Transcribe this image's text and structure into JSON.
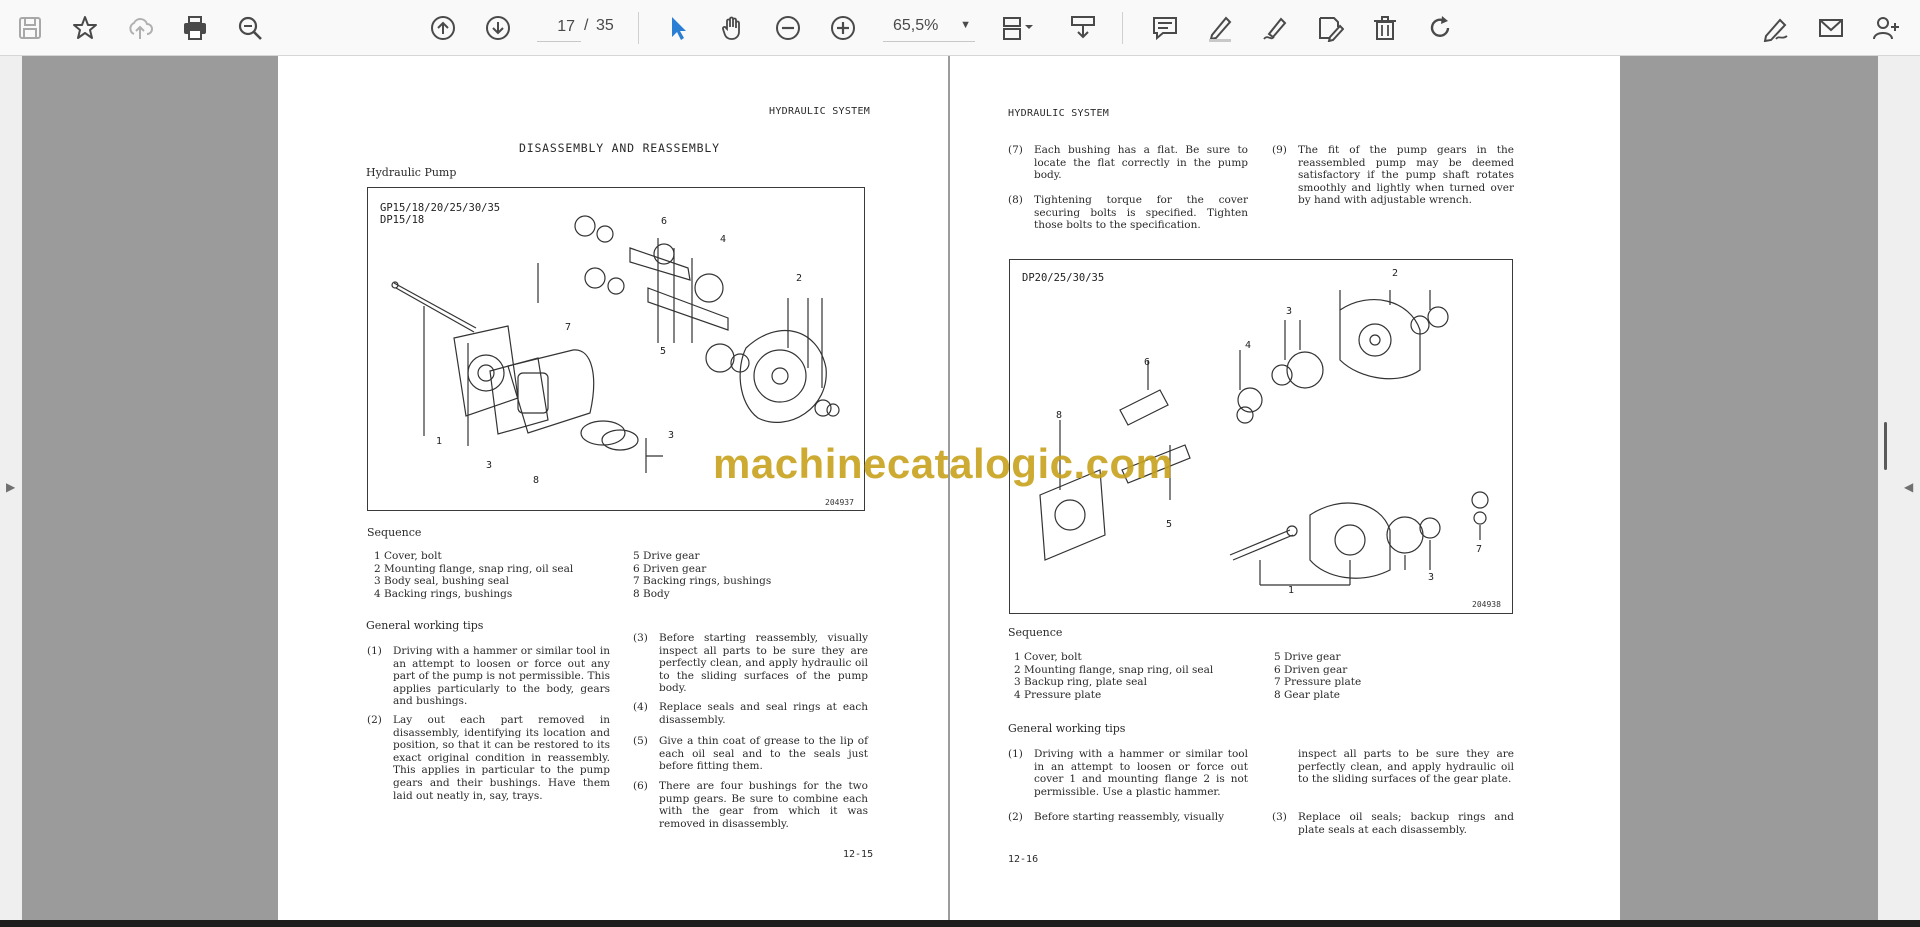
{
  "toolbar": {
    "page_current": "17",
    "page_separator": "/",
    "page_total": "35",
    "zoom": "65,5%",
    "accent_color": "#2a7fd4",
    "icons": [
      "save-icon",
      "bookmark-star-icon",
      "upload-cloud-icon",
      "print-icon",
      "zoom-search-icon",
      "page-up-icon",
      "page-down-icon",
      "select-cursor-icon",
      "hand-pan-icon",
      "zoom-out-icon",
      "zoom-in-icon",
      "page-fit-icon",
      "scroll-mode-icon",
      "comment-icon",
      "highlight-pen-icon",
      "draw-icon",
      "edit-text-icon",
      "delete-trash-icon",
      "rotate-icon",
      "sign-icon",
      "email-icon",
      "add-user-icon"
    ]
  },
  "left_page": {
    "header": "HYDRAULIC SYSTEM",
    "title": "DISASSEMBLY AND REASSEMBLY",
    "subtitle": "Hydraulic Pump",
    "figure": {
      "model_label": "GP15/18/20/25/30/35\nDP15/18",
      "code": "204937",
      "callouts": [
        "6",
        "4",
        "7",
        "2",
        "5",
        "1",
        "3",
        "3",
        "8"
      ]
    },
    "sequence_title": "Sequence",
    "sequence_col1": [
      "1  Cover, bolt",
      "2  Mounting flange, snap ring, oil seal",
      "3  Body seal, bushing seal",
      "4  Backing rings, bushings"
    ],
    "sequence_col2": [
      "5  Drive gear",
      "6  Driven gear",
      "7  Backing rings, bushings",
      "8  Body"
    ],
    "tips_title": "General working tips",
    "tips_col1": [
      {
        "n": "(1)",
        "text": "Driving with a hammer or similar tool in an attempt to loosen or force out any part of the pump is not permissible. This applies particularly to the body, gears and bushings."
      },
      {
        "n": "(2)",
        "text": "Lay out each part removed in disassembly, identifying its location and position, so that it can be restored to its exact original condition in reassembly. This applies in particular to the pump gears and their bushings. Have them laid out neatly in, say, trays."
      }
    ],
    "tips_col2": [
      {
        "n": "(3)",
        "text": "Before starting reassembly, visually inspect all parts to be sure they are perfectly clean, and apply hydraulic oil to the sliding surfaces of the pump body."
      },
      {
        "n": "(4)",
        "text": "Replace seals and seal rings at each disassembly."
      },
      {
        "n": "(5)",
        "text": "Give a thin coat of grease to the lip of each oil seal and to the seals just before fitting them."
      },
      {
        "n": "(6)",
        "text": "There are four bushings for the two pump gears. Be sure to combine each with the gear from which it was removed in disassembly."
      }
    ],
    "page_number": "12-15"
  },
  "right_page": {
    "header": "HYDRAULIC SYSTEM",
    "top_col1": [
      {
        "n": "(7)",
        "text": "Each bushing has a flat. Be sure to locate the flat correctly in the pump body."
      },
      {
        "n": "(8)",
        "text": "Tightening torque for the cover securing bolts is specified. Tighten those bolts to the specification."
      }
    ],
    "top_col2": [
      {
        "n": "(9)",
        "text": "The fit of the pump gears in the reassembled pump may be deemed satisfactory if the pump shaft rotates smoothly and lightly when turned over by hand with adjustable wrench."
      }
    ],
    "figure": {
      "model_label": "DP20/25/30/35",
      "code": "204938",
      "callouts": [
        "2",
        "3",
        "6",
        "4",
        "8",
        "5",
        "1",
        "3",
        "7"
      ]
    },
    "sequence_title": "Sequence",
    "sequence_col1": [
      "1  Cover, bolt",
      "2  Mounting flange, snap ring, oil seal",
      "3  Backup ring, plate seal",
      "4  Pressure plate"
    ],
    "sequence_col2": [
      "5  Drive gear",
      "6  Driven gear",
      "7  Pressure plate",
      "8  Gear plate"
    ],
    "tips_title": "General working tips",
    "tips_col1": [
      {
        "n": "(1)",
        "text": "Driving with a hammer or similar tool in an attempt to loosen or force out cover 1 and mounting flange 2 is not permissible. Use a plastic hammer."
      },
      {
        "n": "(2)",
        "text": "Before starting reassembly, visually"
      }
    ],
    "tips_col2": [
      {
        "n": "",
        "text": "inspect all parts to be sure they are perfectly clean, and apply hydraulic oil to the sliding surfaces of the gear plate."
      },
      {
        "n": "(3)",
        "text": "Replace oil seals; backup rings and plate seals at each disassembly."
      }
    ],
    "page_number": "12-16"
  },
  "watermark": "machinecatalogic.com"
}
